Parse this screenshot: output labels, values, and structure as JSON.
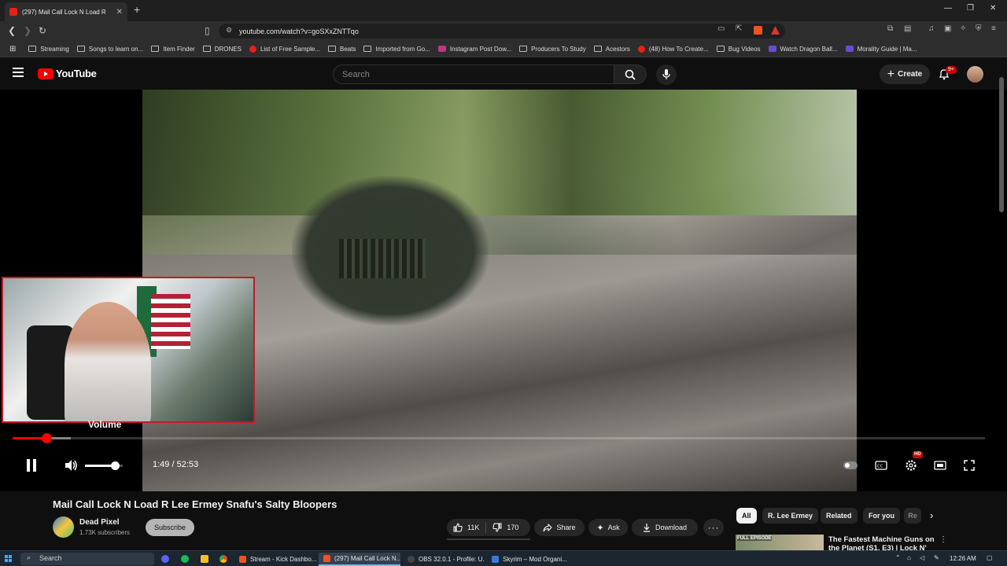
{
  "browser": {
    "tab_title": "(297) Mail Call Lock N Load R",
    "new_tab": "+",
    "url": "youtube.com/watch?v=goSXxZNTTqo",
    "bookmarks": [
      {
        "label": "Streaming",
        "icon": "folder"
      },
      {
        "label": "Songs to learn on...",
        "icon": "folder"
      },
      {
        "label": "Item Finder",
        "icon": "folder"
      },
      {
        "label": "DRONES",
        "icon": "folder"
      },
      {
        "label": "List of Free Sample...",
        "icon": "red"
      },
      {
        "label": "Beats",
        "icon": "folder"
      },
      {
        "label": "Imported from Go...",
        "icon": "folder"
      },
      {
        "label": "Instagram Post Dow...",
        "icon": "pink"
      },
      {
        "label": "Producers To Study",
        "icon": "folder"
      },
      {
        "label": "Acestors",
        "icon": "folder"
      },
      {
        "label": "(48) How To Create...",
        "icon": "red"
      },
      {
        "label": "Bug Videos",
        "icon": "folder"
      },
      {
        "label": "Watch Dragon Ball...",
        "icon": "purple"
      },
      {
        "label": "Morality Guide | Ma...",
        "icon": "purple"
      }
    ]
  },
  "youtube": {
    "logo_text": "YouTube",
    "search_placeholder": "Search",
    "create_label": "Create",
    "notif_badge": "9+"
  },
  "player": {
    "tooltip": "Volume",
    "time": "1:49 / 52:53",
    "progress_played": 0.035,
    "progress_buffered": 0.06,
    "volume_level": 0.8,
    "hd_badge": "HD"
  },
  "video": {
    "title": "Mail Call Lock N Load R Lee Ermey Snafu's Salty Bloopers",
    "channel": "Dead Pixel",
    "subscribers": "1.73K subscribers",
    "subscribe_label": "Subscribe",
    "likes": "11K",
    "dislikes": "170",
    "share_label": "Share",
    "ask_label": "Ask",
    "download_label": "Download"
  },
  "chips": [
    "All",
    "R. Lee Ermey",
    "Related",
    "For you",
    "Re"
  ],
  "recommendation": {
    "thumb_label": "FULL EPISODE",
    "title": "The Fastest Machine Guns on the Planet (S1, E3) | Lock N'"
  },
  "taskbar": {
    "search_placeholder": "Search",
    "tasks": [
      "Stream - Kick Dashbo...",
      "(297) Mail Call Lock N...",
      "OBS 32.0.1 - Profile: U...",
      "Skyrim – Mod Organi..."
    ],
    "clock": "12:26 AM"
  },
  "colors": {
    "accent_red": "#ff0000",
    "background": "#0f0f0f",
    "webcam_border": "#c21a2a"
  }
}
